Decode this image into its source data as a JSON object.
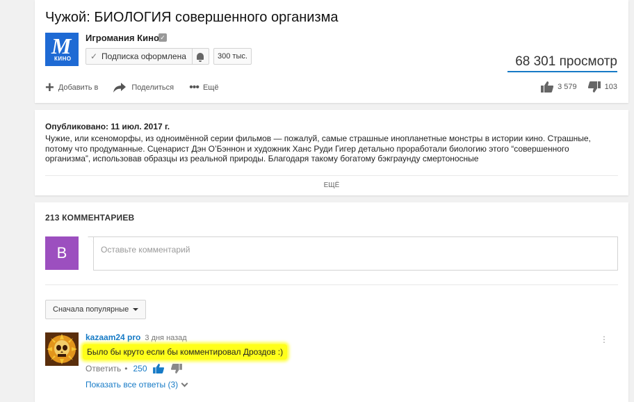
{
  "video": {
    "title": "Чужой: БИОЛОГИЯ совершенного организма",
    "channel_name": "Игромания Кино",
    "channel_logo_letter": "M",
    "channel_logo_caption": "КИНО",
    "subscribe_label": "Подписка оформлена",
    "subscriber_count": "300 тыс.",
    "views": "68 301 просмотр",
    "actions": {
      "add_label": "Добавить в",
      "share_label": "Поделиться",
      "more_label": "Ещё"
    },
    "likes": "3 579",
    "dislikes": "103"
  },
  "description": {
    "published": "Опубликовано: 11 июл. 2017 г.",
    "text": "Чужие, или ксеноморфы, из одноимённой серии фильмов — пожалуй, самые страшные инопланетные монстры в истории кино. Страшные, потому что продуманные. Сценарист Дэн О’Бэннон и художник Ханс Руди Гигер детально проработали биологию этого “совершенного организма”, использовав образцы из реальной природы. Благодаря такому богатому бэкграунду смертоносные",
    "more_label": "ЕЩЁ"
  },
  "comments": {
    "count_label": "213 КОММЕНТАРИЕВ",
    "user_avatar_letter": "B",
    "input_placeholder": "Оставьте комментарий",
    "sort_label": "Сначала популярные",
    "items": [
      {
        "author": "kazaam24 pro",
        "time": "3 дня назад",
        "text": "Было бы круто если бы комментировал Дроздов :)",
        "reply_label": "Ответить",
        "separator": "•",
        "like_count": "250",
        "show_replies_label": "Показать все ответы (3)"
      }
    ]
  },
  "colors": {
    "link_blue": "#167ac6",
    "highlight": "#ffff1a",
    "avatar_purple": "#9c4fbf",
    "channel_blue": "#1e6ad4"
  }
}
